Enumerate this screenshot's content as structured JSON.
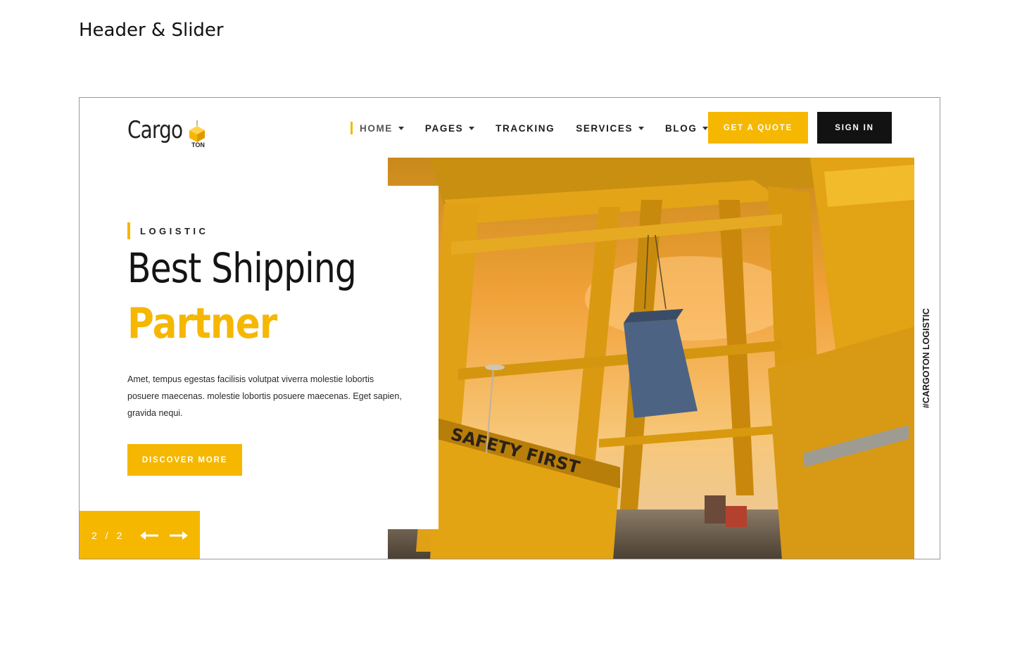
{
  "document": {
    "heading": "Header & Slider"
  },
  "brand": {
    "name": "Cargo",
    "suffix": "TON",
    "accent": "#f5b700",
    "dark": "#121212"
  },
  "nav": {
    "items": [
      {
        "label": "HOME",
        "has_dropdown": true,
        "active": true
      },
      {
        "label": "PAGES",
        "has_dropdown": true,
        "active": false
      },
      {
        "label": "TRACKING",
        "has_dropdown": false,
        "active": false
      },
      {
        "label": "SERVICES",
        "has_dropdown": true,
        "active": false
      },
      {
        "label": "BLOG",
        "has_dropdown": true,
        "active": false
      }
    ],
    "quote_label": "GET A QUOTE",
    "signin_label": "SIGN IN"
  },
  "hero": {
    "eyebrow": "LOGISTIC",
    "title_line1": "Best Shipping",
    "title_line2": "Partner",
    "description": "Amet, tempus egestas facilisis volutpat viverra molestie lobortis posuere maecenas. molestie lobortis posuere maecenas. Eget sapien, gravida nequi.",
    "cta_label": "DISCOVER MORE",
    "pager": {
      "count": "2 / 2",
      "prev_icon": "arrow-left-icon",
      "next_icon": "arrow-right-icon"
    },
    "image_overlay_text": "SAFETY FIRST",
    "side_caption": "#CARGOTON LOGISTIC"
  }
}
